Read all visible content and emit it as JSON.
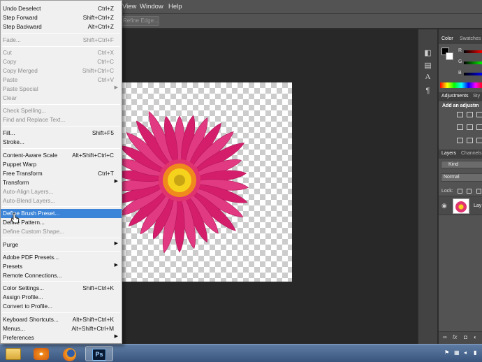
{
  "menubar": {
    "view": "View",
    "window": "Window",
    "help": "Help"
  },
  "options_bar": {
    "refine_edge": "Refine Edge..."
  },
  "edit_menu": {
    "items": [
      {
        "label": "Undo Deselect",
        "shortcut": "Ctrl+Z"
      },
      {
        "label": "Step Forward",
        "shortcut": "Shift+Ctrl+Z"
      },
      {
        "label": "Step Backward",
        "shortcut": "Alt+Ctrl+Z"
      },
      {
        "label": "Fade...",
        "shortcut": "Shift+Ctrl+F"
      },
      {
        "label": "Cut",
        "shortcut": "Ctrl+X"
      },
      {
        "label": "Copy",
        "shortcut": "Ctrl+C"
      },
      {
        "label": "Copy Merged",
        "shortcut": "Shift+Ctrl+C"
      },
      {
        "label": "Paste",
        "shortcut": "Ctrl+V"
      },
      {
        "label": "Paste Special"
      },
      {
        "label": "Clear"
      },
      {
        "label": "Check Spelling..."
      },
      {
        "label": "Find and Replace Text..."
      },
      {
        "label": "Fill...",
        "shortcut": "Shift+F5"
      },
      {
        "label": "Stroke..."
      },
      {
        "label": "Content-Aware Scale",
        "shortcut": "Alt+Shift+Ctrl+C"
      },
      {
        "label": "Puppet Warp"
      },
      {
        "label": "Free Transform",
        "shortcut": "Ctrl+T"
      },
      {
        "label": "Transform"
      },
      {
        "label": "Auto-Align Layers..."
      },
      {
        "label": "Auto-Blend Layers..."
      },
      {
        "label": "Define Brush Preset..."
      },
      {
        "label": "Define Pattern..."
      },
      {
        "label": "Define Custom Shape..."
      },
      {
        "label": "Purge"
      },
      {
        "label": "Adobe PDF Presets..."
      },
      {
        "label": "Presets"
      },
      {
        "label": "Remote Connections..."
      },
      {
        "label": "Color Settings...",
        "shortcut": "Shift+Ctrl+K"
      },
      {
        "label": "Assign Profile..."
      },
      {
        "label": "Convert to Profile..."
      },
      {
        "label": "Keyboard Shortcuts...",
        "shortcut": "Alt+Shift+Ctrl+K"
      },
      {
        "label": "Menus...",
        "shortcut": "Alt+Shift+Ctrl+M"
      },
      {
        "label": "Preferences"
      }
    ]
  },
  "panels": {
    "color_tab": "Color",
    "swatches_tab": "Swatches",
    "channel_r": "R",
    "channel_g": "G",
    "channel_b": "B",
    "adjustments_tab": "Adjustments",
    "styles_tab": "Sty",
    "add_adjustment": "Add an adjustm",
    "layers_tab": "Layers",
    "channels_tab": "Channels",
    "kind_filter": "Kind",
    "blend_mode": "Normal",
    "lock_label": "Lock:",
    "layer_name": "Lay"
  },
  "taskbar": {
    "photoshop_label": "Ps"
  },
  "icons": [
    "explorer-icon",
    "media-player-icon",
    "firefox-icon",
    "photoshop-icon",
    "eye-icon",
    "fx-icon"
  ]
}
